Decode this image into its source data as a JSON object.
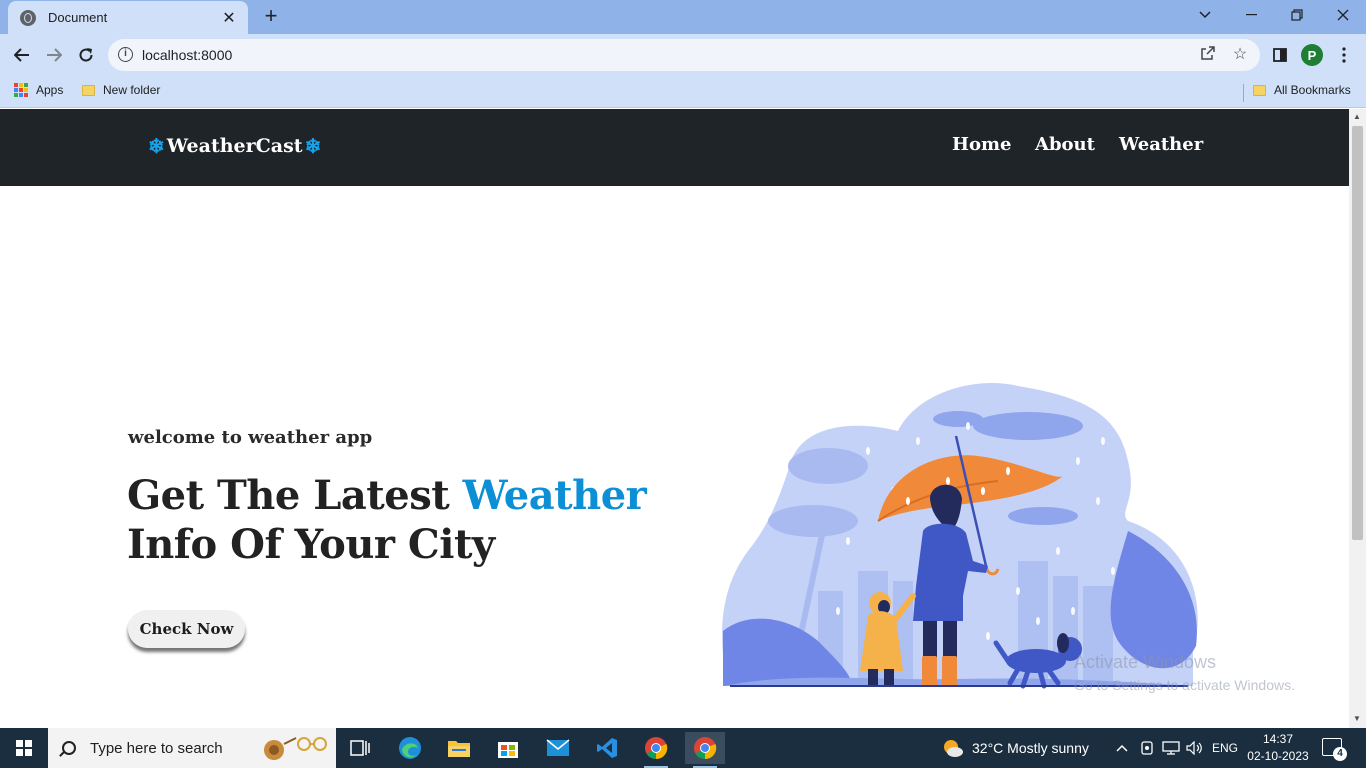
{
  "browser": {
    "tab_title": "Document",
    "url": "localhost:8000",
    "bookmarks": [
      {
        "label": "Apps",
        "icon": "apps-grid-icon"
      },
      {
        "label": "New folder",
        "icon": "folder-icon"
      }
    ],
    "all_bookmarks_label": "All Bookmarks",
    "profile_initial": "P"
  },
  "site": {
    "brand": "WeatherCast",
    "brand_icon": "snowflake-icon",
    "brand_glyph": "❄",
    "nav": [
      "Home",
      "About",
      "Weather"
    ],
    "nav_bg": "#1f2428",
    "accent": "#0d8fd6"
  },
  "hero": {
    "welcome": "welcome to weather app",
    "headline_part1": "Get The Latest",
    "headline_accent": "Weather",
    "headline_line2": "Info Of Your City",
    "cta": "Check Now"
  },
  "watermark": {
    "line1": "Activate Windows",
    "line2": "Go to Settings to activate Windows."
  },
  "taskbar": {
    "search_placeholder": "Type here to search",
    "weather": "32°C  Mostly sunny",
    "language": "ENG",
    "time": "14:37",
    "date": "02-10-2023",
    "notification_count": "4"
  }
}
